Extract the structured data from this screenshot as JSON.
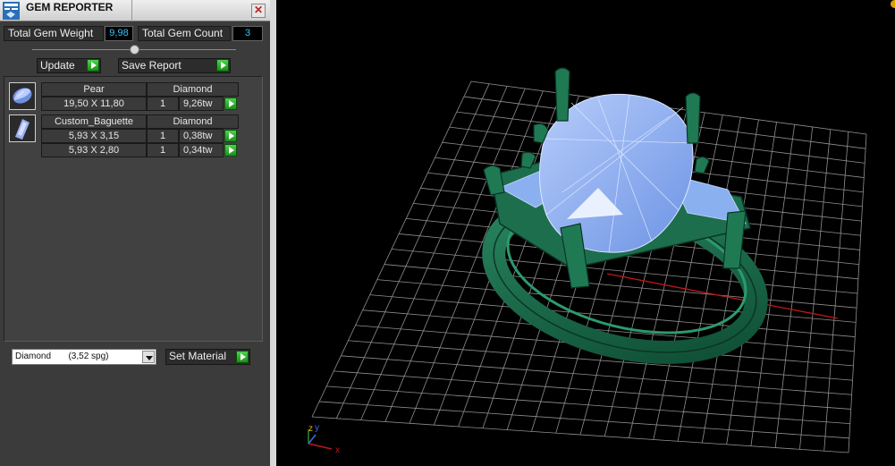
{
  "window": {
    "title": "GEM REPORTER",
    "close_symbol": "✕"
  },
  "summary": {
    "total_weight_label": "Total Gem Weight",
    "total_weight_value": "9,98",
    "total_count_label": "Total Gem Count",
    "total_count_value": "3"
  },
  "toolbar": {
    "update_label": "Update",
    "save_label": "Save Report"
  },
  "gems": [
    {
      "shape": "Pear",
      "material": "Diamond",
      "rows": [
        {
          "size": "19,50 X 11,80",
          "qty": "1",
          "weight": "9,26tw"
        }
      ]
    },
    {
      "shape": "Custom_Baguette",
      "material": "Diamond",
      "rows": [
        {
          "size": "5,93 X 3,15",
          "qty": "1",
          "weight": "0,38tw"
        },
        {
          "size": "5,93 X 2,80",
          "qty": "1",
          "weight": "0,34tw"
        }
      ]
    }
  ],
  "material": {
    "selected": "Diamond       (3,52 spg)",
    "set_label": "Set Material"
  },
  "viewport": {
    "axis_labels": {
      "x": "x",
      "y": "y",
      "z": "z"
    }
  },
  "colors": {
    "accent_value": "#35c2ff",
    "play_green": "#2db52d",
    "ring_green": "#1b6b4c",
    "gem_blue": "#8db2f2"
  }
}
